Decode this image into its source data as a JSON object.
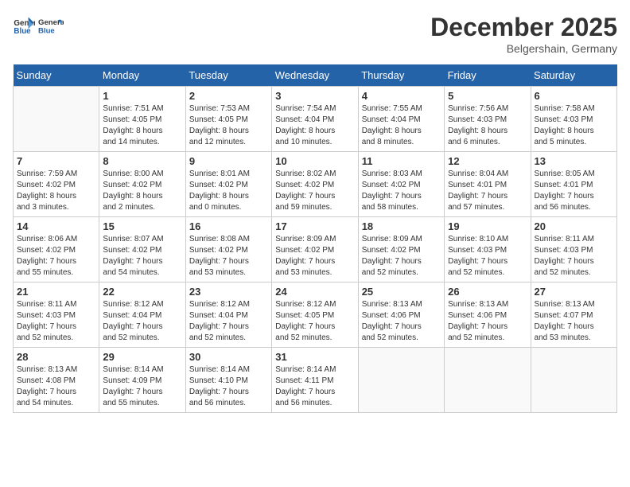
{
  "header": {
    "logo_line1": "General",
    "logo_line2": "Blue",
    "month_year": "December 2025",
    "location": "Belgershain, Germany"
  },
  "weekdays": [
    "Sunday",
    "Monday",
    "Tuesday",
    "Wednesday",
    "Thursday",
    "Friday",
    "Saturday"
  ],
  "weeks": [
    [
      {
        "day": "",
        "info": ""
      },
      {
        "day": "1",
        "info": "Sunrise: 7:51 AM\nSunset: 4:05 PM\nDaylight: 8 hours\nand 14 minutes."
      },
      {
        "day": "2",
        "info": "Sunrise: 7:53 AM\nSunset: 4:05 PM\nDaylight: 8 hours\nand 12 minutes."
      },
      {
        "day": "3",
        "info": "Sunrise: 7:54 AM\nSunset: 4:04 PM\nDaylight: 8 hours\nand 10 minutes."
      },
      {
        "day": "4",
        "info": "Sunrise: 7:55 AM\nSunset: 4:04 PM\nDaylight: 8 hours\nand 8 minutes."
      },
      {
        "day": "5",
        "info": "Sunrise: 7:56 AM\nSunset: 4:03 PM\nDaylight: 8 hours\nand 6 minutes."
      },
      {
        "day": "6",
        "info": "Sunrise: 7:58 AM\nSunset: 4:03 PM\nDaylight: 8 hours\nand 5 minutes."
      }
    ],
    [
      {
        "day": "7",
        "info": "Sunrise: 7:59 AM\nSunset: 4:02 PM\nDaylight: 8 hours\nand 3 minutes."
      },
      {
        "day": "8",
        "info": "Sunrise: 8:00 AM\nSunset: 4:02 PM\nDaylight: 8 hours\nand 2 minutes."
      },
      {
        "day": "9",
        "info": "Sunrise: 8:01 AM\nSunset: 4:02 PM\nDaylight: 8 hours\nand 0 minutes."
      },
      {
        "day": "10",
        "info": "Sunrise: 8:02 AM\nSunset: 4:02 PM\nDaylight: 7 hours\nand 59 minutes."
      },
      {
        "day": "11",
        "info": "Sunrise: 8:03 AM\nSunset: 4:02 PM\nDaylight: 7 hours\nand 58 minutes."
      },
      {
        "day": "12",
        "info": "Sunrise: 8:04 AM\nSunset: 4:01 PM\nDaylight: 7 hours\nand 57 minutes."
      },
      {
        "day": "13",
        "info": "Sunrise: 8:05 AM\nSunset: 4:01 PM\nDaylight: 7 hours\nand 56 minutes."
      }
    ],
    [
      {
        "day": "14",
        "info": "Sunrise: 8:06 AM\nSunset: 4:02 PM\nDaylight: 7 hours\nand 55 minutes."
      },
      {
        "day": "15",
        "info": "Sunrise: 8:07 AM\nSunset: 4:02 PM\nDaylight: 7 hours\nand 54 minutes."
      },
      {
        "day": "16",
        "info": "Sunrise: 8:08 AM\nSunset: 4:02 PM\nDaylight: 7 hours\nand 53 minutes."
      },
      {
        "day": "17",
        "info": "Sunrise: 8:09 AM\nSunset: 4:02 PM\nDaylight: 7 hours\nand 53 minutes."
      },
      {
        "day": "18",
        "info": "Sunrise: 8:09 AM\nSunset: 4:02 PM\nDaylight: 7 hours\nand 52 minutes."
      },
      {
        "day": "19",
        "info": "Sunrise: 8:10 AM\nSunset: 4:03 PM\nDaylight: 7 hours\nand 52 minutes."
      },
      {
        "day": "20",
        "info": "Sunrise: 8:11 AM\nSunset: 4:03 PM\nDaylight: 7 hours\nand 52 minutes."
      }
    ],
    [
      {
        "day": "21",
        "info": "Sunrise: 8:11 AM\nSunset: 4:03 PM\nDaylight: 7 hours\nand 52 minutes."
      },
      {
        "day": "22",
        "info": "Sunrise: 8:12 AM\nSunset: 4:04 PM\nDaylight: 7 hours\nand 52 minutes."
      },
      {
        "day": "23",
        "info": "Sunrise: 8:12 AM\nSunset: 4:04 PM\nDaylight: 7 hours\nand 52 minutes."
      },
      {
        "day": "24",
        "info": "Sunrise: 8:12 AM\nSunset: 4:05 PM\nDaylight: 7 hours\nand 52 minutes."
      },
      {
        "day": "25",
        "info": "Sunrise: 8:13 AM\nSunset: 4:06 PM\nDaylight: 7 hours\nand 52 minutes."
      },
      {
        "day": "26",
        "info": "Sunrise: 8:13 AM\nSunset: 4:06 PM\nDaylight: 7 hours\nand 52 minutes."
      },
      {
        "day": "27",
        "info": "Sunrise: 8:13 AM\nSunset: 4:07 PM\nDaylight: 7 hours\nand 53 minutes."
      }
    ],
    [
      {
        "day": "28",
        "info": "Sunrise: 8:13 AM\nSunset: 4:08 PM\nDaylight: 7 hours\nand 54 minutes."
      },
      {
        "day": "29",
        "info": "Sunrise: 8:14 AM\nSunset: 4:09 PM\nDaylight: 7 hours\nand 55 minutes."
      },
      {
        "day": "30",
        "info": "Sunrise: 8:14 AM\nSunset: 4:10 PM\nDaylight: 7 hours\nand 56 minutes."
      },
      {
        "day": "31",
        "info": "Sunrise: 8:14 AM\nSunset: 4:11 PM\nDaylight: 7 hours\nand 56 minutes."
      },
      {
        "day": "",
        "info": ""
      },
      {
        "day": "",
        "info": ""
      },
      {
        "day": "",
        "info": ""
      }
    ]
  ]
}
